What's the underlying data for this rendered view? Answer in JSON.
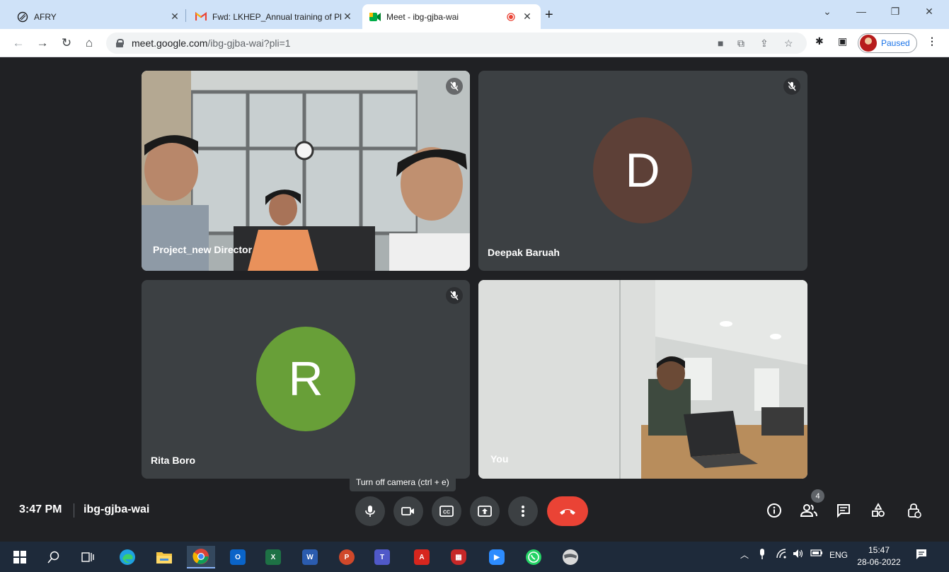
{
  "browser": {
    "tabs": [
      {
        "title": "AFRY",
        "close": "✕"
      },
      {
        "title": "Fwd: LKHEP_Annual training of Pl",
        "close": "✕"
      },
      {
        "title": "Meet - ibg-gjba-wai",
        "close": "✕"
      }
    ],
    "new_tab": "+",
    "url_host": "meet.google.com",
    "url_path": "/ibg-gjba-wai?pli=1",
    "profile_status": "Paused"
  },
  "meet": {
    "participants": [
      {
        "name": "Project_new Director",
        "avatar_letter": "",
        "muted": true
      },
      {
        "name": "Deepak Baruah",
        "avatar_letter": "D",
        "avatar_color": "#5d4037",
        "muted": true
      },
      {
        "name": "Rita Boro",
        "avatar_letter": "R",
        "avatar_color": "#689f38",
        "muted": true
      },
      {
        "name": "You",
        "avatar_letter": "",
        "muted": false
      }
    ],
    "tooltip": "Turn off camera (ctrl + e)",
    "time": "3:47 PM",
    "meeting_code": "ibg-gjba-wai",
    "people_count": "4"
  },
  "taskbar": {
    "language": "ENG",
    "time": "15:47",
    "date": "28-06-2022"
  }
}
